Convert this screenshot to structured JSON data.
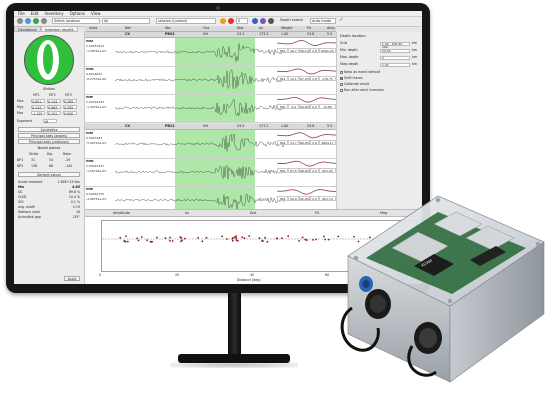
{
  "menu": [
    "File",
    "Edit",
    "Inventory",
    "Options",
    "View"
  ],
  "toolbar": {
    "network_field": "Select location",
    "station_field": "All",
    "session_field": "session (Locked)",
    "depth_label": "Depth search",
    "auto_label": "Auto mode"
  },
  "left_tabs": [
    "Deviations",
    "Inversion results"
  ],
  "left_panel": {
    "strikes_label": "Strikes",
    "columns": [
      "MT1",
      "MT2",
      "MT3"
    ],
    "rows": [
      {
        "label": "Mxx",
        "v1": "0.801",
        "v2": "0.144",
        "v3": "0.265"
      },
      {
        "label": "Myy",
        "v1": "0.144",
        "v2": "0.963",
        "v3": "0.355"
      },
      {
        "label": "Mzz",
        "v1": "-1.125",
        "v2": "0.101",
        "v3": "0.000"
      }
    ],
    "exponent_label": "Exponent",
    "exponent_value": "16",
    "synthetics_btn": "Synthetics",
    "principal_btn": "Principal axes (angles)",
    "principal_btn2": "Principal axes (cartesian)",
    "nodal_label": "Nodal planes",
    "nodal_headers": [
      "Strike",
      "Dip",
      "Rake"
    ],
    "nodal_rows": [
      {
        "label": "NP1",
        "s": "31",
        "d": "54",
        "r": "-29"
      },
      {
        "label": "NP2",
        "s": "138",
        "d": "66",
        "r": "-140"
      }
    ],
    "derived_label": "Derived values",
    "derived": [
      {
        "k": "Scalar moment",
        "v": "2.85E+15 Nm"
      },
      {
        "k": "Mw",
        "v": "4.65"
      },
      {
        "k": "DC",
        "v": "89.6 %"
      },
      {
        "k": "CLVD",
        "v": "10.4 %"
      },
      {
        "k": "ISO",
        "v": "0.1 %"
      },
      {
        "k": "avg. misfit",
        "v": "0.19"
      },
      {
        "k": "Stations used",
        "v": "16"
      },
      {
        "k": "Azimuthal gap",
        "v": "135°"
      }
    ],
    "apply_btn": "Apply"
  },
  "trace_headers": [
    "Used",
    "Net",
    "Sta",
    "Cha",
    "Dist",
    "Az",
    "Weight",
    "Fit",
    "Amp"
  ],
  "trace_groups": [
    {
      "net": "CX",
      "sta": "PB03",
      "cha": "HH",
      "dist": "24.3",
      "az": "173.2",
      "weight": "1.00",
      "fit": "53.8",
      "amp": "5.5",
      "rows": [
        {
          "comp": "HHZ",
          "a": "0.00451502",
          "b": "-1.08761e-05",
          "c1": "389",
          "c2": "49.7",
          "c3": "99.1%",
          "c4": "2.8",
          "c5": "6991.25"
        },
        {
          "comp": "HHN",
          "a": "0.0018041",
          "b": "-8.27534e-06",
          "c1": "392",
          "c2": "12.1",
          "c3": "97.2%",
          "c4": "2.8",
          "c5": "176.75"
        },
        {
          "comp": "HHE",
          "a": "0.00164187",
          "b": "-1.40761e-05",
          "c1": "390",
          "c2": "9.0",
          "c3": "94.9%",
          "c4": "0.0",
          "c5": "72.80"
        }
      ]
    },
    {
      "net": "CX",
      "sta": "PB12",
      "cha": "HH",
      "dist": "24.9",
      "az": "177.2",
      "weight": "1.00",
      "fit": "53.8",
      "amp": "5.5",
      "rows": [
        {
          "comp": "HHZ",
          "a": "0.0023183",
          "b": "-5.99793e-05",
          "c1": "396",
          "c2": "31.7",
          "c3": "89.9%",
          "c4": "2.0",
          "c5": "4824.17"
        },
        {
          "comp": "HHN",
          "a": "0.00091457",
          "b": "-1.66794e-05",
          "c1": "396",
          "c2": "87.5",
          "c3": "98.9%",
          "c4": "2.0",
          "c5": "601.05"
        },
        {
          "comp": "HHE",
          "a": "0.00461755",
          "b": "-4.98761e-05",
          "c1": "396",
          "c2": "50.9",
          "c3": "92.9%",
          "c4": "2.0",
          "c5": "801.79"
        }
      ]
    }
  ],
  "right_panel": {
    "title": "Depth location",
    "rows": [
      {
        "label": "Grid",
        "value": "1.00 - 400.50 - 100",
        "unit": "km"
      },
      {
        "label": "Min. depth",
        "value": "50.50",
        "unit": "km"
      },
      {
        "label": "Max. depth",
        "value": "2",
        "unit": "km"
      },
      {
        "label": "Step depth",
        "value": "1.00",
        "unit": "km"
      }
    ],
    "checks": [
      {
        "label": "Keep as event default",
        "on": false
      },
      {
        "label": "Shift traces",
        "on": true
      },
      {
        "label": "Calibrate result",
        "on": false
      },
      {
        "label": "Run after each inversion",
        "on": false
      }
    ]
  },
  "bottom": {
    "tabs": [
      "Amplitude",
      "Az",
      "Dist",
      "Fit",
      "Mag"
    ],
    "x_ticks": [
      "0",
      "20",
      "40",
      "60"
    ],
    "x_label": "Distance [deg]"
  },
  "colors": {
    "trace_highlight": "#aee8a8",
    "beachball": "#2fbf3a",
    "marker": "#8b1a1a"
  }
}
